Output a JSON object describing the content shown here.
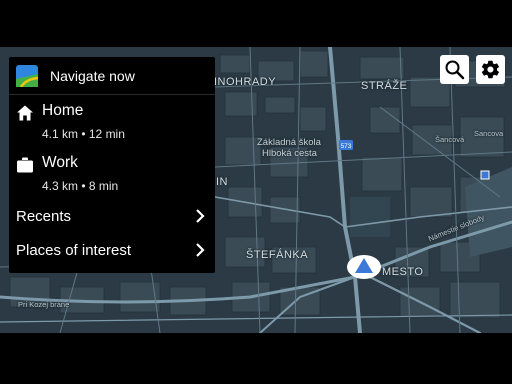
{
  "panel": {
    "app_title": "Navigate now",
    "destinations": [
      {
        "icon": "home-icon",
        "name": "Home",
        "meta": "4.1 km • 12 min"
      },
      {
        "icon": "briefcase-icon",
        "name": "Work",
        "meta": "4.3 km • 8 min"
      }
    ],
    "links": [
      {
        "label": "Recents"
      },
      {
        "label": "Places of interest"
      }
    ]
  },
  "top_buttons": {
    "search": "search-icon",
    "settings": "gear-icon"
  },
  "map": {
    "labels": {
      "vinohrady": "INOHRADY",
      "straze": "STRÁŽE",
      "sancova": "Sancova",
      "sancova2": "Šancová",
      "school_line1": "Základná škola",
      "school_line2": "Hlboká cesta",
      "road_num": "573",
      "stefanka": "ŠTEFÁNKA",
      "mesto": "MESTO",
      "prikozej": "Pri Kozej bráne",
      "namestie": "Námestie slobody",
      "side_in": "IN"
    },
    "colors": {
      "land": "#2b3a44",
      "road": "#7d9aaa",
      "water": "#465e6c",
      "accent": "#3c78d8"
    }
  }
}
